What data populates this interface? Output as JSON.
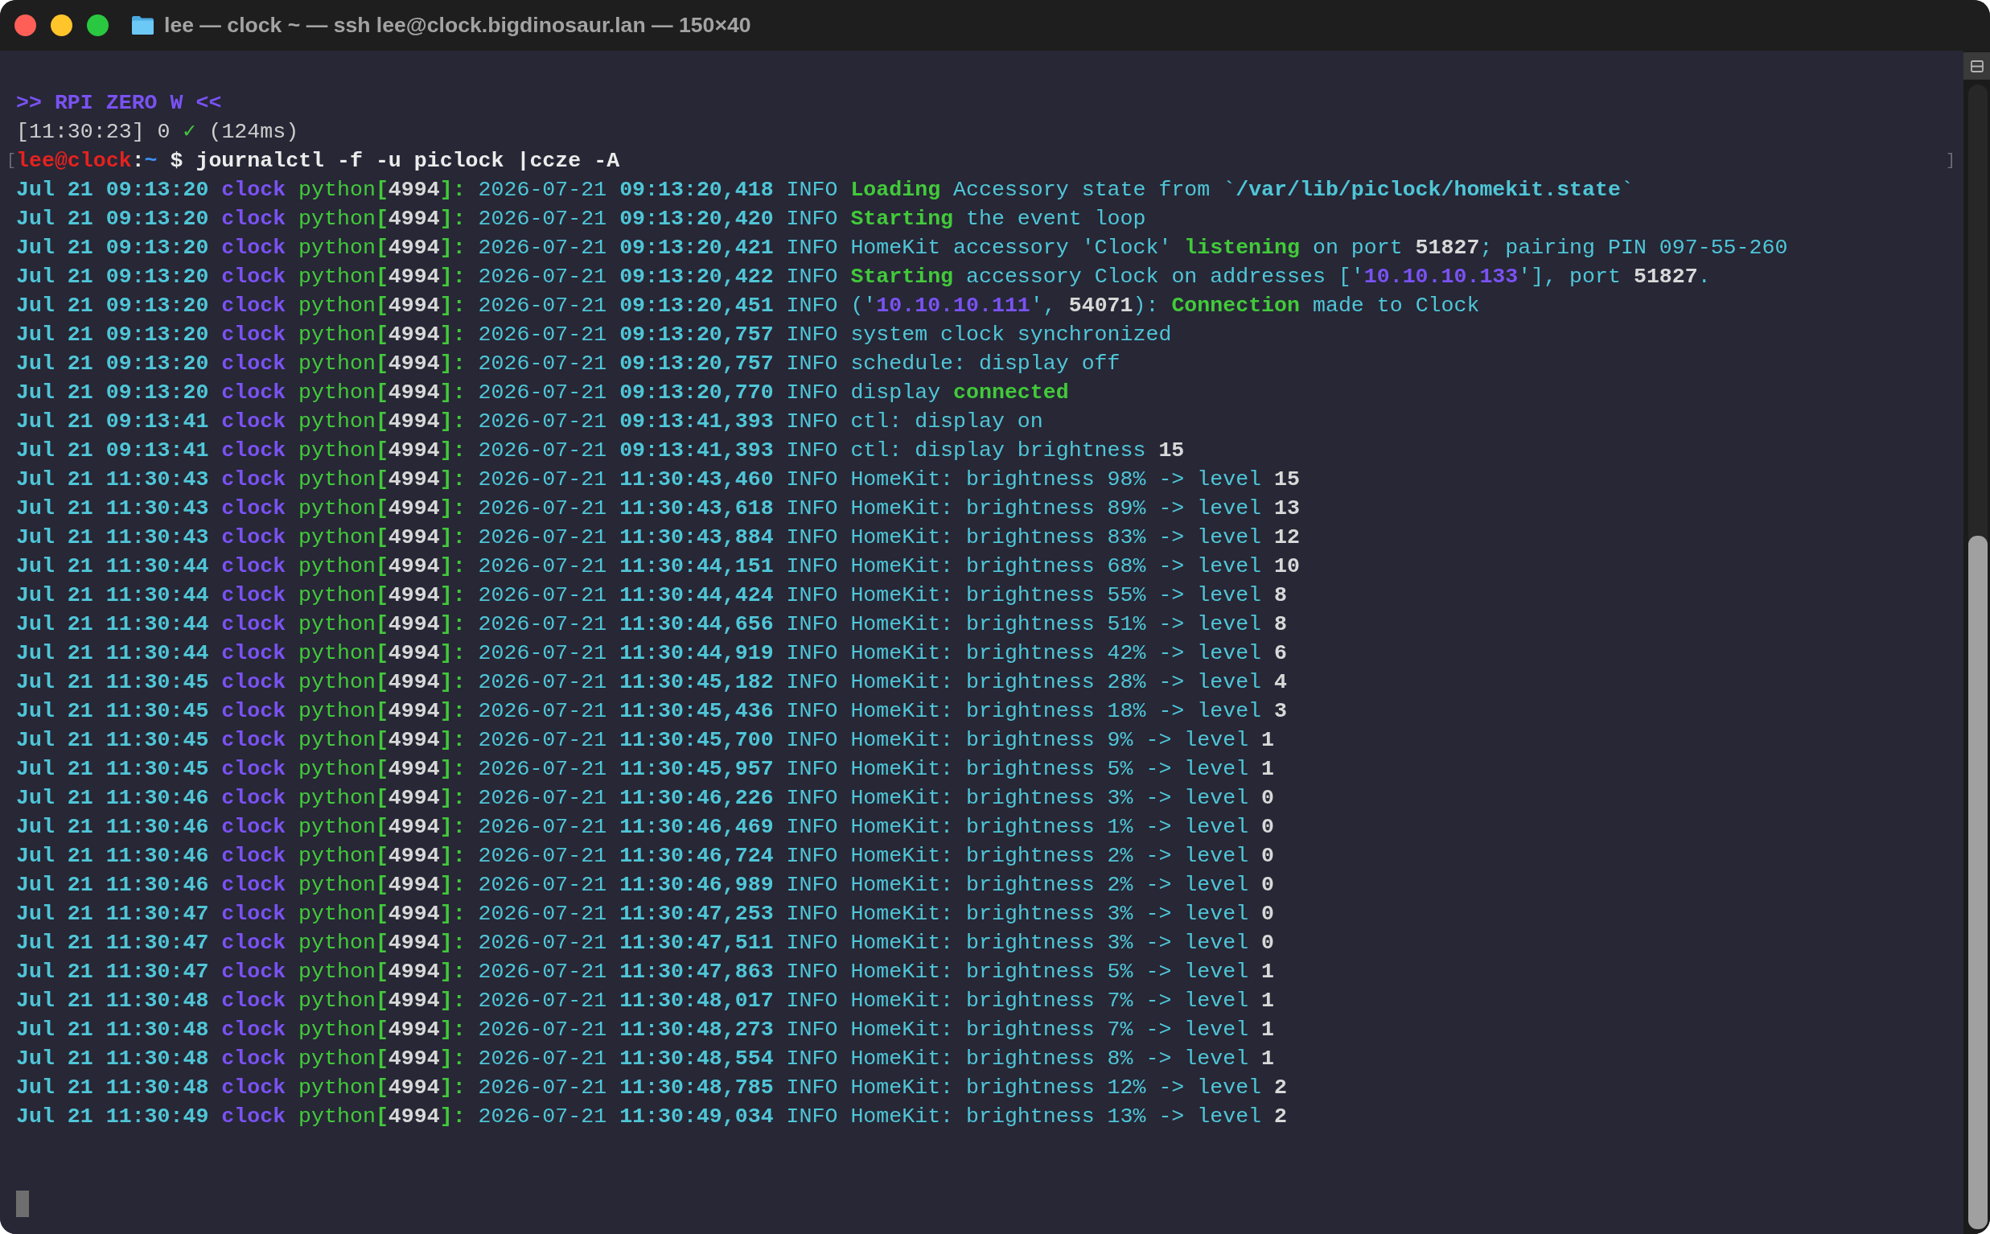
{
  "window": {
    "title": "lee — clock ~ — ssh lee@clock.bigdinosaur.lan — 150×40"
  },
  "terminal": {
    "lines": [
      {
        "kind": "banner",
        "segments": [
          {
            "text": ">> RPI ZERO W <<"
          }
        ]
      },
      {
        "kind": "status",
        "segments": [
          {
            "text": "[11:30:23] 0 "
          },
          {
            "kind": "ok",
            "text": "✓"
          },
          {
            "text": " (124ms)"
          }
        ]
      },
      {
        "kind": "prompt",
        "marker_left": "[",
        "marker_right": "]",
        "segments": [
          {
            "kind": "user",
            "text": "lee@clock"
          },
          {
            "text": ":"
          },
          {
            "kind": "path",
            "text": "~"
          },
          {
            "text": " $ journalctl -f -u piclock |ccze -A"
          }
        ]
      },
      {
        "kind": "log",
        "segments": [
          {
            "kind": "stamp",
            "text": "Jul 21 09:13:20 "
          },
          {
            "kind": "host",
            "text": "clock "
          },
          {
            "kind": "proc",
            "text": "python"
          },
          {
            "kind": "punct",
            "text": "["
          },
          {
            "kind": "num",
            "text": "4994"
          },
          {
            "kind": "punct",
            "text": "]:"
          },
          {
            "text": " 2026-07-21 "
          },
          {
            "kind": "stamp",
            "text": "09:13:20,418"
          },
          {
            "text": " INFO "
          },
          {
            "kind": "key",
            "text": "Loading"
          },
          {
            "text": " Accessory state from `"
          },
          {
            "kind": "stamp",
            "text": "/var/lib/piclock/homekit.state"
          },
          {
            "text": "`"
          }
        ]
      },
      {
        "kind": "log",
        "segments": [
          {
            "kind": "stamp",
            "text": "Jul 21 09:13:20 "
          },
          {
            "kind": "host",
            "text": "clock "
          },
          {
            "kind": "proc",
            "text": "python"
          },
          {
            "kind": "punct",
            "text": "["
          },
          {
            "kind": "num",
            "text": "4994"
          },
          {
            "kind": "punct",
            "text": "]:"
          },
          {
            "text": " 2026-07-21 "
          },
          {
            "kind": "stamp",
            "text": "09:13:20,420"
          },
          {
            "text": " INFO "
          },
          {
            "kind": "key",
            "text": "Starting"
          },
          {
            "text": " the event loop"
          }
        ]
      },
      {
        "kind": "log",
        "segments": [
          {
            "kind": "stamp",
            "text": "Jul 21 09:13:20 "
          },
          {
            "kind": "host",
            "text": "clock "
          },
          {
            "kind": "proc",
            "text": "python"
          },
          {
            "kind": "punct",
            "text": "["
          },
          {
            "kind": "num",
            "text": "4994"
          },
          {
            "kind": "punct",
            "text": "]:"
          },
          {
            "text": " 2026-07-21 "
          },
          {
            "kind": "stamp",
            "text": "09:13:20,421"
          },
          {
            "text": " INFO HomeKit accessory 'Clock' "
          },
          {
            "kind": "key",
            "text": "listening"
          },
          {
            "text": " on port "
          },
          {
            "kind": "num",
            "text": "51827"
          },
          {
            "text": "; pairing PIN 097-55-260"
          }
        ]
      },
      {
        "kind": "log",
        "segments": [
          {
            "kind": "stamp",
            "text": "Jul 21 09:13:20 "
          },
          {
            "kind": "host",
            "text": "clock "
          },
          {
            "kind": "proc",
            "text": "python"
          },
          {
            "kind": "punct",
            "text": "["
          },
          {
            "kind": "num",
            "text": "4994"
          },
          {
            "kind": "punct",
            "text": "]:"
          },
          {
            "text": " 2026-07-21 "
          },
          {
            "kind": "stamp",
            "text": "09:13:20,422"
          },
          {
            "text": " INFO "
          },
          {
            "kind": "key",
            "text": "Starting"
          },
          {
            "text": " accessory Clock on addresses ['"
          },
          {
            "kind": "host",
            "text": "10.10.10.133"
          },
          {
            "text": "'], port "
          },
          {
            "kind": "num",
            "text": "51827"
          },
          {
            "text": "."
          }
        ]
      },
      {
        "kind": "log",
        "segments": [
          {
            "kind": "stamp",
            "text": "Jul 21 09:13:20 "
          },
          {
            "kind": "host",
            "text": "clock "
          },
          {
            "kind": "proc",
            "text": "python"
          },
          {
            "kind": "punct",
            "text": "["
          },
          {
            "kind": "num",
            "text": "4994"
          },
          {
            "kind": "punct",
            "text": "]:"
          },
          {
            "text": " 2026-07-21 "
          },
          {
            "kind": "stamp",
            "text": "09:13:20,451"
          },
          {
            "text": " INFO ('"
          },
          {
            "kind": "host",
            "text": "10.10.10.111"
          },
          {
            "text": "', "
          },
          {
            "kind": "num",
            "text": "54071"
          },
          {
            "text": "): "
          },
          {
            "kind": "key",
            "text": "Connection"
          },
          {
            "text": " made to Clock"
          }
        ]
      },
      {
        "kind": "log",
        "segments": [
          {
            "kind": "stamp",
            "text": "Jul 21 09:13:20 "
          },
          {
            "kind": "host",
            "text": "clock "
          },
          {
            "kind": "proc",
            "text": "python"
          },
          {
            "kind": "punct",
            "text": "["
          },
          {
            "kind": "num",
            "text": "4994"
          },
          {
            "kind": "punct",
            "text": "]:"
          },
          {
            "text": " 2026-07-21 "
          },
          {
            "kind": "stamp",
            "text": "09:13:20,757"
          },
          {
            "text": " INFO system clock synchronized"
          }
        ]
      },
      {
        "kind": "log",
        "segments": [
          {
            "kind": "stamp",
            "text": "Jul 21 09:13:20 "
          },
          {
            "kind": "host",
            "text": "clock "
          },
          {
            "kind": "proc",
            "text": "python"
          },
          {
            "kind": "punct",
            "text": "["
          },
          {
            "kind": "num",
            "text": "4994"
          },
          {
            "kind": "punct",
            "text": "]:"
          },
          {
            "text": " 2026-07-21 "
          },
          {
            "kind": "stamp",
            "text": "09:13:20,757"
          },
          {
            "text": " INFO schedule: display off"
          }
        ]
      },
      {
        "kind": "log",
        "segments": [
          {
            "kind": "stamp",
            "text": "Jul 21 09:13:20 "
          },
          {
            "kind": "host",
            "text": "clock "
          },
          {
            "kind": "proc",
            "text": "python"
          },
          {
            "kind": "punct",
            "text": "["
          },
          {
            "kind": "num",
            "text": "4994"
          },
          {
            "kind": "punct",
            "text": "]:"
          },
          {
            "text": " 2026-07-21 "
          },
          {
            "kind": "stamp",
            "text": "09:13:20,770"
          },
          {
            "text": " INFO display "
          },
          {
            "kind": "key",
            "text": "connected"
          }
        ]
      },
      {
        "kind": "log",
        "segments": [
          {
            "kind": "stamp",
            "text": "Jul 21 09:13:41 "
          },
          {
            "kind": "host",
            "text": "clock "
          },
          {
            "kind": "proc",
            "text": "python"
          },
          {
            "kind": "punct",
            "text": "["
          },
          {
            "kind": "num",
            "text": "4994"
          },
          {
            "kind": "punct",
            "text": "]:"
          },
          {
            "text": " 2026-07-21 "
          },
          {
            "kind": "stamp",
            "text": "09:13:41,393"
          },
          {
            "text": " INFO ctl: display on"
          }
        ]
      },
      {
        "kind": "log",
        "segments": [
          {
            "kind": "stamp",
            "text": "Jul 21 09:13:41 "
          },
          {
            "kind": "host",
            "text": "clock "
          },
          {
            "kind": "proc",
            "text": "python"
          },
          {
            "kind": "punct",
            "text": "["
          },
          {
            "kind": "num",
            "text": "4994"
          },
          {
            "kind": "punct",
            "text": "]:"
          },
          {
            "text": " 2026-07-21 "
          },
          {
            "kind": "stamp",
            "text": "09:13:41,393"
          },
          {
            "text": " INFO ctl: display brightness "
          },
          {
            "kind": "num",
            "text": "15"
          }
        ]
      },
      {
        "kind": "log",
        "segments": [
          {
            "kind": "stamp",
            "text": "Jul 21 11:30:43 "
          },
          {
            "kind": "host",
            "text": "clock "
          },
          {
            "kind": "proc",
            "text": "python"
          },
          {
            "kind": "punct",
            "text": "["
          },
          {
            "kind": "num",
            "text": "4994"
          },
          {
            "kind": "punct",
            "text": "]:"
          },
          {
            "text": " 2026-07-21 "
          },
          {
            "kind": "stamp",
            "text": "11:30:43,460"
          },
          {
            "text": " INFO HomeKit: brightness 98% -> level "
          },
          {
            "kind": "num",
            "text": "15"
          }
        ]
      },
      {
        "kind": "log",
        "segments": [
          {
            "kind": "stamp",
            "text": "Jul 21 11:30:43 "
          },
          {
            "kind": "host",
            "text": "clock "
          },
          {
            "kind": "proc",
            "text": "python"
          },
          {
            "kind": "punct",
            "text": "["
          },
          {
            "kind": "num",
            "text": "4994"
          },
          {
            "kind": "punct",
            "text": "]:"
          },
          {
            "text": " 2026-07-21 "
          },
          {
            "kind": "stamp",
            "text": "11:30:43,618"
          },
          {
            "text": " INFO HomeKit: brightness 89% -> level "
          },
          {
            "kind": "num",
            "text": "13"
          }
        ]
      },
      {
        "kind": "log",
        "segments": [
          {
            "kind": "stamp",
            "text": "Jul 21 11:30:43 "
          },
          {
            "kind": "host",
            "text": "clock "
          },
          {
            "kind": "proc",
            "text": "python"
          },
          {
            "kind": "punct",
            "text": "["
          },
          {
            "kind": "num",
            "text": "4994"
          },
          {
            "kind": "punct",
            "text": "]:"
          },
          {
            "text": " 2026-07-21 "
          },
          {
            "kind": "stamp",
            "text": "11:30:43,884"
          },
          {
            "text": " INFO HomeKit: brightness 83% -> level "
          },
          {
            "kind": "num",
            "text": "12"
          }
        ]
      },
      {
        "kind": "log",
        "segments": [
          {
            "kind": "stamp",
            "text": "Jul 21 11:30:44 "
          },
          {
            "kind": "host",
            "text": "clock "
          },
          {
            "kind": "proc",
            "text": "python"
          },
          {
            "kind": "punct",
            "text": "["
          },
          {
            "kind": "num",
            "text": "4994"
          },
          {
            "kind": "punct",
            "text": "]:"
          },
          {
            "text": " 2026-07-21 "
          },
          {
            "kind": "stamp",
            "text": "11:30:44,151"
          },
          {
            "text": " INFO HomeKit: brightness 68% -> level "
          },
          {
            "kind": "num",
            "text": "10"
          }
        ]
      },
      {
        "kind": "log",
        "segments": [
          {
            "kind": "stamp",
            "text": "Jul 21 11:30:44 "
          },
          {
            "kind": "host",
            "text": "clock "
          },
          {
            "kind": "proc",
            "text": "python"
          },
          {
            "kind": "punct",
            "text": "["
          },
          {
            "kind": "num",
            "text": "4994"
          },
          {
            "kind": "punct",
            "text": "]:"
          },
          {
            "text": " 2026-07-21 "
          },
          {
            "kind": "stamp",
            "text": "11:30:44,424"
          },
          {
            "text": " INFO HomeKit: brightness 55% -> level "
          },
          {
            "kind": "num",
            "text": "8"
          }
        ]
      },
      {
        "kind": "log",
        "segments": [
          {
            "kind": "stamp",
            "text": "Jul 21 11:30:44 "
          },
          {
            "kind": "host",
            "text": "clock "
          },
          {
            "kind": "proc",
            "text": "python"
          },
          {
            "kind": "punct",
            "text": "["
          },
          {
            "kind": "num",
            "text": "4994"
          },
          {
            "kind": "punct",
            "text": "]:"
          },
          {
            "text": " 2026-07-21 "
          },
          {
            "kind": "stamp",
            "text": "11:30:44,656"
          },
          {
            "text": " INFO HomeKit: brightness 51% -> level "
          },
          {
            "kind": "num",
            "text": "8"
          }
        ]
      },
      {
        "kind": "log",
        "segments": [
          {
            "kind": "stamp",
            "text": "Jul 21 11:30:44 "
          },
          {
            "kind": "host",
            "text": "clock "
          },
          {
            "kind": "proc",
            "text": "python"
          },
          {
            "kind": "punct",
            "text": "["
          },
          {
            "kind": "num",
            "text": "4994"
          },
          {
            "kind": "punct",
            "text": "]:"
          },
          {
            "text": " 2026-07-21 "
          },
          {
            "kind": "stamp",
            "text": "11:30:44,919"
          },
          {
            "text": " INFO HomeKit: brightness 42% -> level "
          },
          {
            "kind": "num",
            "text": "6"
          }
        ]
      },
      {
        "kind": "log",
        "segments": [
          {
            "kind": "stamp",
            "text": "Jul 21 11:30:45 "
          },
          {
            "kind": "host",
            "text": "clock "
          },
          {
            "kind": "proc",
            "text": "python"
          },
          {
            "kind": "punct",
            "text": "["
          },
          {
            "kind": "num",
            "text": "4994"
          },
          {
            "kind": "punct",
            "text": "]:"
          },
          {
            "text": " 2026-07-21 "
          },
          {
            "kind": "stamp",
            "text": "11:30:45,182"
          },
          {
            "text": " INFO HomeKit: brightness 28% -> level "
          },
          {
            "kind": "num",
            "text": "4"
          }
        ]
      },
      {
        "kind": "log",
        "segments": [
          {
            "kind": "stamp",
            "text": "Jul 21 11:30:45 "
          },
          {
            "kind": "host",
            "text": "clock "
          },
          {
            "kind": "proc",
            "text": "python"
          },
          {
            "kind": "punct",
            "text": "["
          },
          {
            "kind": "num",
            "text": "4994"
          },
          {
            "kind": "punct",
            "text": "]:"
          },
          {
            "text": " 2026-07-21 "
          },
          {
            "kind": "stamp",
            "text": "11:30:45,436"
          },
          {
            "text": " INFO HomeKit: brightness 18% -> level "
          },
          {
            "kind": "num",
            "text": "3"
          }
        ]
      },
      {
        "kind": "log",
        "segments": [
          {
            "kind": "stamp",
            "text": "Jul 21 11:30:45 "
          },
          {
            "kind": "host",
            "text": "clock "
          },
          {
            "kind": "proc",
            "text": "python"
          },
          {
            "kind": "punct",
            "text": "["
          },
          {
            "kind": "num",
            "text": "4994"
          },
          {
            "kind": "punct",
            "text": "]:"
          },
          {
            "text": " 2026-07-21 "
          },
          {
            "kind": "stamp",
            "text": "11:30:45,700"
          },
          {
            "text": " INFO HomeKit: brightness 9% -> level "
          },
          {
            "kind": "num",
            "text": "1"
          }
        ]
      },
      {
        "kind": "log",
        "segments": [
          {
            "kind": "stamp",
            "text": "Jul 21 11:30:45 "
          },
          {
            "kind": "host",
            "text": "clock "
          },
          {
            "kind": "proc",
            "text": "python"
          },
          {
            "kind": "punct",
            "text": "["
          },
          {
            "kind": "num",
            "text": "4994"
          },
          {
            "kind": "punct",
            "text": "]:"
          },
          {
            "text": " 2026-07-21 "
          },
          {
            "kind": "stamp",
            "text": "11:30:45,957"
          },
          {
            "text": " INFO HomeKit: brightness 5% -> level "
          },
          {
            "kind": "num",
            "text": "1"
          }
        ]
      },
      {
        "kind": "log",
        "segments": [
          {
            "kind": "stamp",
            "text": "Jul 21 11:30:46 "
          },
          {
            "kind": "host",
            "text": "clock "
          },
          {
            "kind": "proc",
            "text": "python"
          },
          {
            "kind": "punct",
            "text": "["
          },
          {
            "kind": "num",
            "text": "4994"
          },
          {
            "kind": "punct",
            "text": "]:"
          },
          {
            "text": " 2026-07-21 "
          },
          {
            "kind": "stamp",
            "text": "11:30:46,226"
          },
          {
            "text": " INFO HomeKit: brightness 3% -> level "
          },
          {
            "kind": "num",
            "text": "0"
          }
        ]
      },
      {
        "kind": "log",
        "segments": [
          {
            "kind": "stamp",
            "text": "Jul 21 11:30:46 "
          },
          {
            "kind": "host",
            "text": "clock "
          },
          {
            "kind": "proc",
            "text": "python"
          },
          {
            "kind": "punct",
            "text": "["
          },
          {
            "kind": "num",
            "text": "4994"
          },
          {
            "kind": "punct",
            "text": "]:"
          },
          {
            "text": " 2026-07-21 "
          },
          {
            "kind": "stamp",
            "text": "11:30:46,469"
          },
          {
            "text": " INFO HomeKit: brightness 1% -> level "
          },
          {
            "kind": "num",
            "text": "0"
          }
        ]
      },
      {
        "kind": "log",
        "segments": [
          {
            "kind": "stamp",
            "text": "Jul 21 11:30:46 "
          },
          {
            "kind": "host",
            "text": "clock "
          },
          {
            "kind": "proc",
            "text": "python"
          },
          {
            "kind": "punct",
            "text": "["
          },
          {
            "kind": "num",
            "text": "4994"
          },
          {
            "kind": "punct",
            "text": "]:"
          },
          {
            "text": " 2026-07-21 "
          },
          {
            "kind": "stamp",
            "text": "11:30:46,724"
          },
          {
            "text": " INFO HomeKit: brightness 2% -> level "
          },
          {
            "kind": "num",
            "text": "0"
          }
        ]
      },
      {
        "kind": "log",
        "segments": [
          {
            "kind": "stamp",
            "text": "Jul 21 11:30:46 "
          },
          {
            "kind": "host",
            "text": "clock "
          },
          {
            "kind": "proc",
            "text": "python"
          },
          {
            "kind": "punct",
            "text": "["
          },
          {
            "kind": "num",
            "text": "4994"
          },
          {
            "kind": "punct",
            "text": "]:"
          },
          {
            "text": " 2026-07-21 "
          },
          {
            "kind": "stamp",
            "text": "11:30:46,989"
          },
          {
            "text": " INFO HomeKit: brightness 2% -> level "
          },
          {
            "kind": "num",
            "text": "0"
          }
        ]
      },
      {
        "kind": "log",
        "segments": [
          {
            "kind": "stamp",
            "text": "Jul 21 11:30:47 "
          },
          {
            "kind": "host",
            "text": "clock "
          },
          {
            "kind": "proc",
            "text": "python"
          },
          {
            "kind": "punct",
            "text": "["
          },
          {
            "kind": "num",
            "text": "4994"
          },
          {
            "kind": "punct",
            "text": "]:"
          },
          {
            "text": " 2026-07-21 "
          },
          {
            "kind": "stamp",
            "text": "11:30:47,253"
          },
          {
            "text": " INFO HomeKit: brightness 3% -> level "
          },
          {
            "kind": "num",
            "text": "0"
          }
        ]
      },
      {
        "kind": "log",
        "segments": [
          {
            "kind": "stamp",
            "text": "Jul 21 11:30:47 "
          },
          {
            "kind": "host",
            "text": "clock "
          },
          {
            "kind": "proc",
            "text": "python"
          },
          {
            "kind": "punct",
            "text": "["
          },
          {
            "kind": "num",
            "text": "4994"
          },
          {
            "kind": "punct",
            "text": "]:"
          },
          {
            "text": " 2026-07-21 "
          },
          {
            "kind": "stamp",
            "text": "11:30:47,511"
          },
          {
            "text": " INFO HomeKit: brightness 3% -> level "
          },
          {
            "kind": "num",
            "text": "0"
          }
        ]
      },
      {
        "kind": "log",
        "segments": [
          {
            "kind": "stamp",
            "text": "Jul 21 11:30:47 "
          },
          {
            "kind": "host",
            "text": "clock "
          },
          {
            "kind": "proc",
            "text": "python"
          },
          {
            "kind": "punct",
            "text": "["
          },
          {
            "kind": "num",
            "text": "4994"
          },
          {
            "kind": "punct",
            "text": "]:"
          },
          {
            "text": " 2026-07-21 "
          },
          {
            "kind": "stamp",
            "text": "11:30:47,863"
          },
          {
            "text": " INFO HomeKit: brightness 5% -> level "
          },
          {
            "kind": "num",
            "text": "1"
          }
        ]
      },
      {
        "kind": "log",
        "segments": [
          {
            "kind": "stamp",
            "text": "Jul 21 11:30:48 "
          },
          {
            "kind": "host",
            "text": "clock "
          },
          {
            "kind": "proc",
            "text": "python"
          },
          {
            "kind": "punct",
            "text": "["
          },
          {
            "kind": "num",
            "text": "4994"
          },
          {
            "kind": "punct",
            "text": "]:"
          },
          {
            "text": " 2026-07-21 "
          },
          {
            "kind": "stamp",
            "text": "11:30:48,017"
          },
          {
            "text": " INFO HomeKit: brightness 7% -> level "
          },
          {
            "kind": "num",
            "text": "1"
          }
        ]
      },
      {
        "kind": "log",
        "segments": [
          {
            "kind": "stamp",
            "text": "Jul 21 11:30:48 "
          },
          {
            "kind": "host",
            "text": "clock "
          },
          {
            "kind": "proc",
            "text": "python"
          },
          {
            "kind": "punct",
            "text": "["
          },
          {
            "kind": "num",
            "text": "4994"
          },
          {
            "kind": "punct",
            "text": "]:"
          },
          {
            "text": " 2026-07-21 "
          },
          {
            "kind": "stamp",
            "text": "11:30:48,273"
          },
          {
            "text": " INFO HomeKit: brightness 7% -> level "
          },
          {
            "kind": "num",
            "text": "1"
          }
        ]
      },
      {
        "kind": "log",
        "segments": [
          {
            "kind": "stamp",
            "text": "Jul 21 11:30:48 "
          },
          {
            "kind": "host",
            "text": "clock "
          },
          {
            "kind": "proc",
            "text": "python"
          },
          {
            "kind": "punct",
            "text": "["
          },
          {
            "kind": "num",
            "text": "4994"
          },
          {
            "kind": "punct",
            "text": "]:"
          },
          {
            "text": " 2026-07-21 "
          },
          {
            "kind": "stamp",
            "text": "11:30:48,554"
          },
          {
            "text": " INFO HomeKit: brightness 8% -> level "
          },
          {
            "kind": "num",
            "text": "1"
          }
        ]
      },
      {
        "kind": "log",
        "segments": [
          {
            "kind": "stamp",
            "text": "Jul 21 11:30:48 "
          },
          {
            "kind": "host",
            "text": "clock "
          },
          {
            "kind": "proc",
            "text": "python"
          },
          {
            "kind": "punct",
            "text": "["
          },
          {
            "kind": "num",
            "text": "4994"
          },
          {
            "kind": "punct",
            "text": "]:"
          },
          {
            "text": " 2026-07-21 "
          },
          {
            "kind": "stamp",
            "text": "11:30:48,785"
          },
          {
            "text": " INFO HomeKit: brightness 12% -> level "
          },
          {
            "kind": "num",
            "text": "2"
          }
        ]
      },
      {
        "kind": "log",
        "segments": [
          {
            "kind": "stamp",
            "text": "Jul 21 11:30:49 "
          },
          {
            "kind": "host",
            "text": "clock "
          },
          {
            "kind": "proc",
            "text": "python"
          },
          {
            "kind": "punct",
            "text": "["
          },
          {
            "kind": "num",
            "text": "4994"
          },
          {
            "kind": "punct",
            "text": "]:"
          },
          {
            "text": " 2026-07-21 "
          },
          {
            "kind": "stamp",
            "text": "11:30:49,034"
          },
          {
            "text": " INFO HomeKit: brightness 13% -> level "
          },
          {
            "kind": "num",
            "text": "2"
          }
        ]
      }
    ]
  }
}
